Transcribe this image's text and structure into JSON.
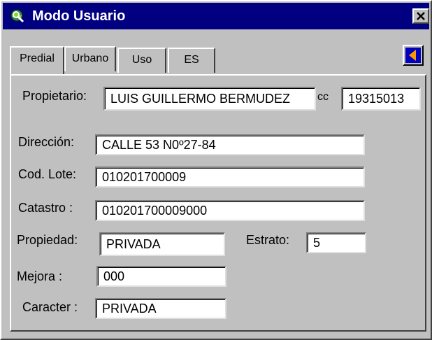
{
  "window": {
    "title": "Modo Usuario",
    "icon": "globe-magnifier-icon",
    "close_icon": "close-icon"
  },
  "tabs": [
    {
      "label": "Predial",
      "active": true
    },
    {
      "label": "Urbano",
      "active": false
    },
    {
      "label": "Uso",
      "active": false
    },
    {
      "label": "ES",
      "active": false
    }
  ],
  "nav_button": {
    "icon": "arrow-left-icon",
    "colors": {
      "bg": "#0000c0",
      "arrow": "#ff9900"
    }
  },
  "form": {
    "propietario": {
      "label": "Propietario:",
      "value": "LUIS GUILLERMO BERMUDEZ"
    },
    "cc": {
      "label": "cc",
      "value": "19315013"
    },
    "direccion": {
      "label": "Dirección:",
      "value": "CALLE 53  N0º27-84"
    },
    "cod_lote": {
      "label": "Cod. Lote:",
      "value": "010201700009"
    },
    "catastro": {
      "label": "Catastro  :",
      "value": "010201700009000"
    },
    "propiedad": {
      "label": "Propiedad:",
      "value": "PRIVADA"
    },
    "estrato": {
      "label": "Estrato:",
      "value": "5"
    },
    "mejora": {
      "label": "Mejora    :",
      "value": "000"
    },
    "caracter": {
      "label": "Caracter :",
      "value": "PRIVADA"
    }
  }
}
